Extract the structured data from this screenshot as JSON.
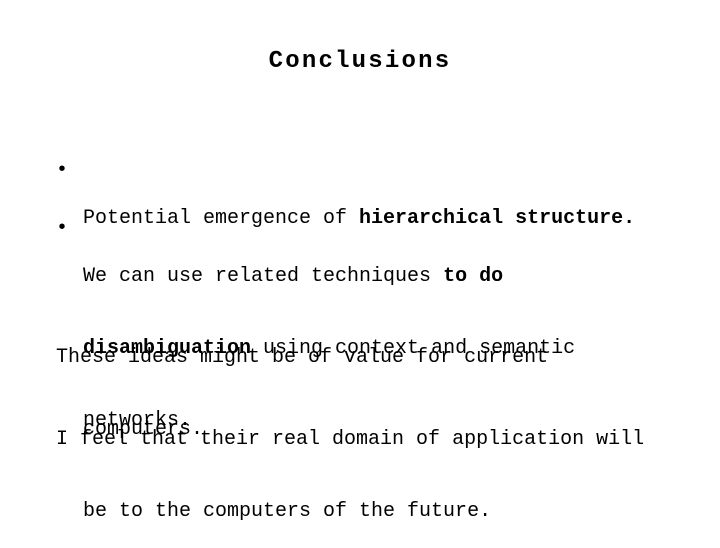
{
  "slide": {
    "title": "Conclusions",
    "bullets": [
      {
        "marker": "•",
        "line1": {
          "a": "Potential emergence of ",
          "b": "hierarchical structure."
        }
      },
      {
        "marker": "•",
        "line1": {
          "a": "We can use related techniques ",
          "b": "to do"
        },
        "line2": {
          "b": "disambiguation",
          "a": " using context and semantic"
        },
        "line3": "networks."
      }
    ],
    "paragraphs": [
      {
        "line1": "These ideas might be of value for current",
        "line2": "computers."
      },
      {
        "line1": "I feel that their real domain of application will",
        "line2": "be to the computers of the future."
      }
    ]
  }
}
